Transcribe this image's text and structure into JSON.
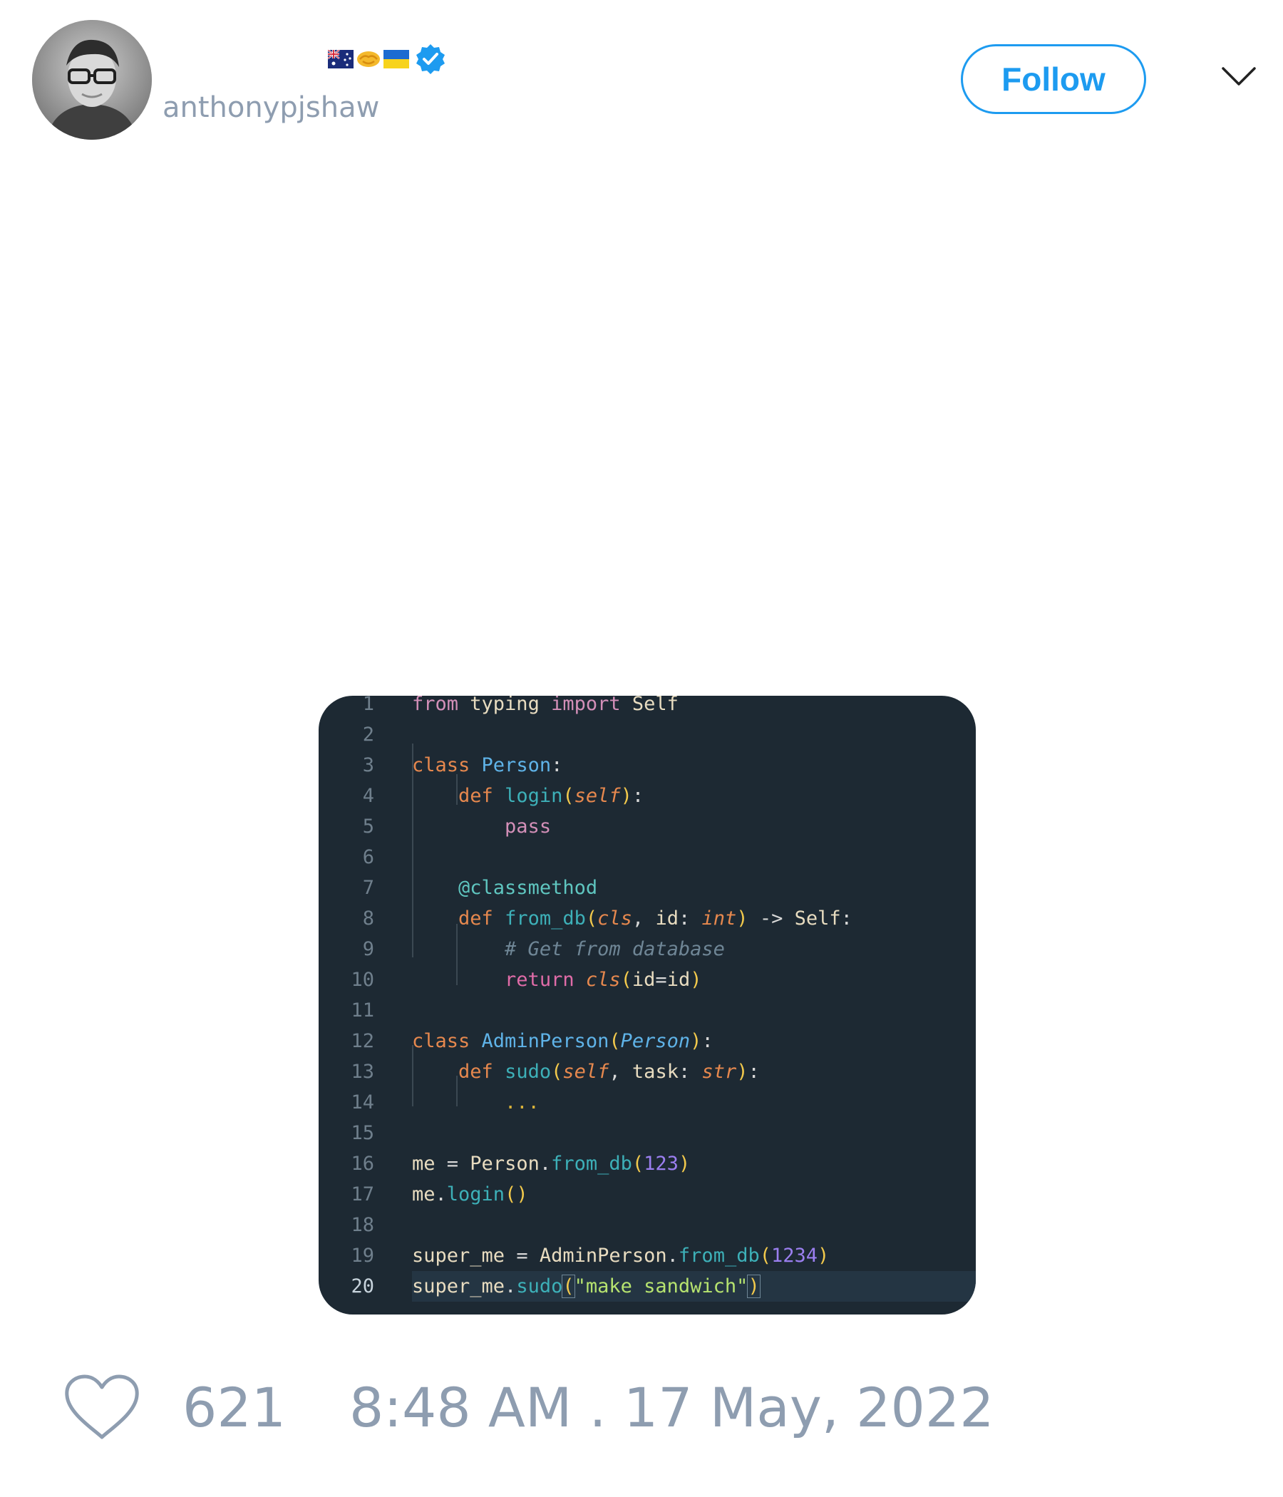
{
  "tweet": {
    "author": {
      "handle": "anthonypjshaw",
      "flags": [
        "australia-flag",
        "handshake-icon",
        "ukraine-flag"
      ],
      "verified": true
    },
    "follow_label": "Follow",
    "likes": "621",
    "timestamp": "8:48 AM . 17 May, 2022"
  },
  "code": {
    "active_line": 20,
    "line_numbers": [
      "1",
      "2",
      "3",
      "4",
      "5",
      "6",
      "7",
      "8",
      "9",
      "10",
      "11",
      "12",
      "13",
      "14",
      "15",
      "16",
      "17",
      "18",
      "19",
      "20"
    ],
    "lines": [
      "from typing import Self",
      "",
      "class Person:",
      "    def login(self):",
      "        pass",
      "",
      "    @classmethod",
      "    def from_db(cls, id: int) -> Self:",
      "        # Get from database",
      "        return cls(id=id)",
      "",
      "class AdminPerson(Person):",
      "    def sudo(self, task: str):",
      "        ...",
      "",
      "me = Person.from_db(123)",
      "me.login()",
      "",
      "super_me = AdminPerson.from_db(1234)",
      "super_me.sudo(\"make sandwich\")"
    ]
  },
  "colors": {
    "accent": "#1d9bf0",
    "muted_text": "#8e9db0",
    "code_background": "#1d2933"
  }
}
